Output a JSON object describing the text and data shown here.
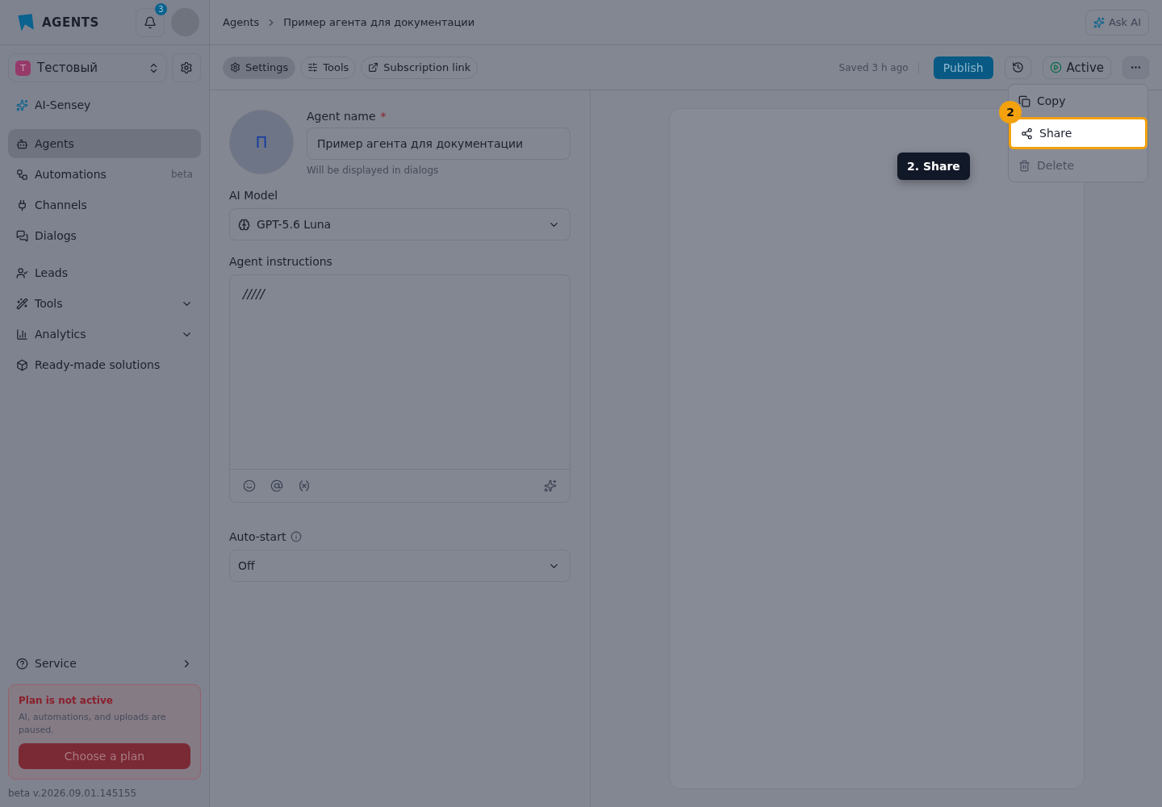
{
  "sidebar": {
    "logo": "AGENTS",
    "notification_count": "3",
    "workspace": {
      "initial": "T",
      "name": "Тестовый"
    },
    "top_item": {
      "label": "AI-Sensey"
    },
    "items": [
      {
        "label": "Agents",
        "selected": true,
        "kind": "link"
      },
      {
        "label": "Automations",
        "selected": false,
        "kind": "link",
        "badge": "beta"
      },
      {
        "label": "Channels",
        "selected": false,
        "kind": "link"
      },
      {
        "label": "Dialogs",
        "selected": false,
        "kind": "link"
      },
      {
        "label": "Leads",
        "selected": false,
        "kind": "link"
      },
      {
        "label": "Tools",
        "selected": false,
        "kind": "expandable"
      },
      {
        "label": "Analytics",
        "selected": false,
        "kind": "expandable"
      },
      {
        "label": "Ready-made solutions",
        "selected": false,
        "kind": "link"
      }
    ],
    "service": {
      "label": "Service"
    },
    "plan_notice": {
      "title": "Plan is not active",
      "text": "AI, automations, and uploads are paused.",
      "button": "Choose a plan"
    },
    "version": "beta v.2026.09.01.145155"
  },
  "header": {
    "breadcrumbs": [
      "Agents",
      "Пример агента для документации"
    ],
    "ask_ai": "Ask AI"
  },
  "toolbar": {
    "tabs": [
      {
        "label": "Settings",
        "selected": true
      },
      {
        "label": "Tools",
        "selected": false
      },
      {
        "label": "Subscription link",
        "selected": false
      }
    ],
    "saved": "Saved 3 h ago",
    "publish": "Publish",
    "status": "Active"
  },
  "form": {
    "avatar_initial": "П",
    "name_label": "Agent name",
    "required_mark": "*",
    "name_value": "Пример агента для документации",
    "name_hint": "Will be displayed in dialogs",
    "model_label": "AI Model",
    "model_value": "GPT-5.6 Luna",
    "instructions_label": "Agent instructions",
    "instructions_value": "/////",
    "autostart_label": "Auto-start",
    "autostart_value": "Off"
  },
  "menu": {
    "items": [
      {
        "label": "Copy",
        "highlighted": false
      },
      {
        "label": "Share",
        "highlighted": true
      },
      {
        "label": "Delete",
        "highlighted": false
      }
    ]
  },
  "tour": {
    "step": "2",
    "tooltip": "2. Share"
  }
}
